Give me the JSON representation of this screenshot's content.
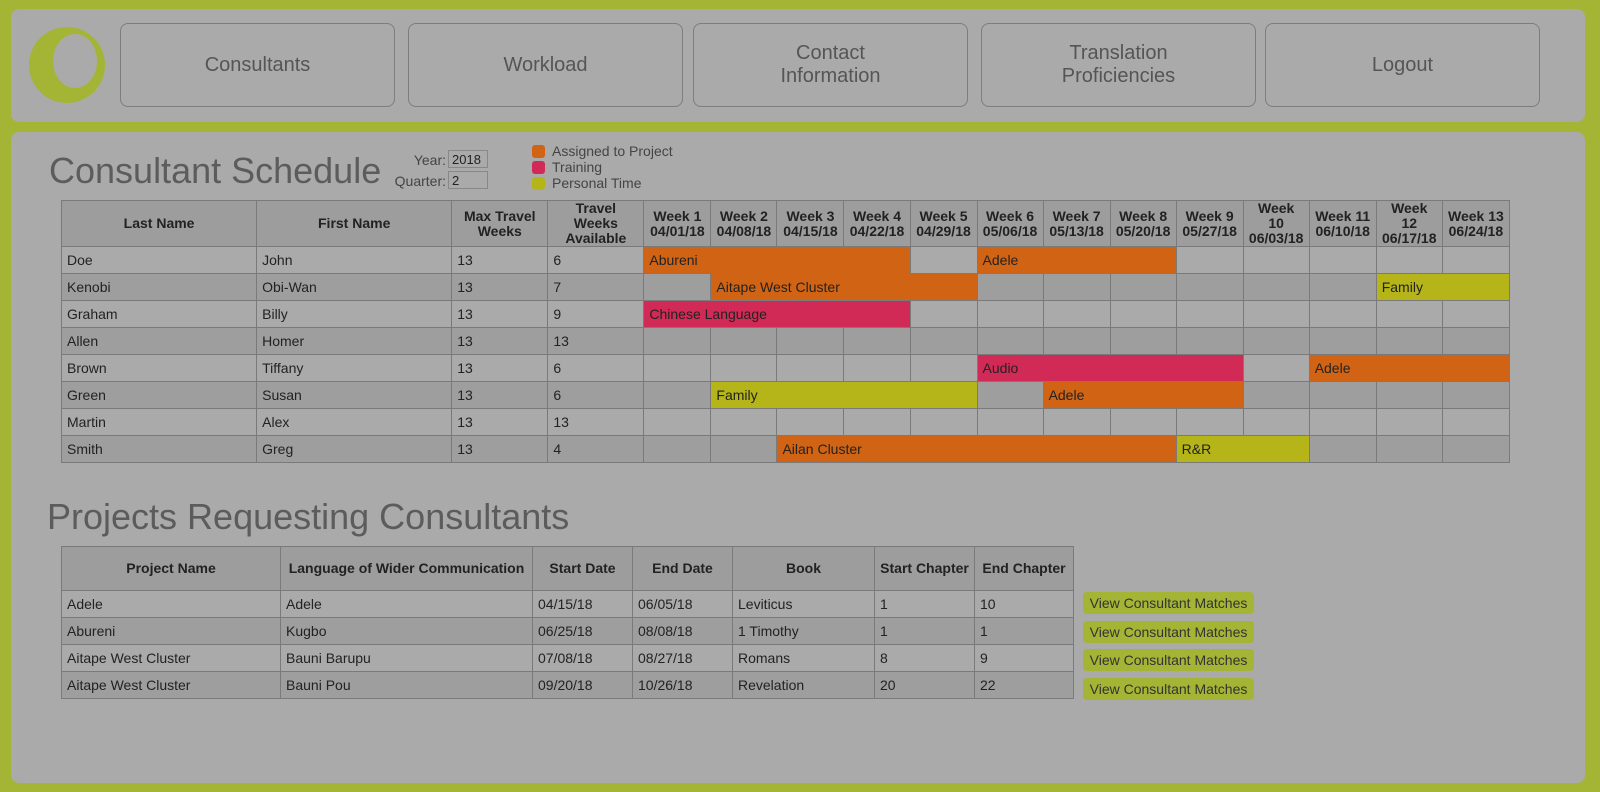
{
  "nav": {
    "items": [
      {
        "label": "Consultants"
      },
      {
        "label": "Workload"
      },
      {
        "label": "Contact\nInformation"
      },
      {
        "label": "Translation\nProficiencies"
      },
      {
        "label": "Logout"
      }
    ]
  },
  "colors": {
    "brand": "#a4b535",
    "assigned": "#d16414",
    "training": "#d22a56",
    "personal": "#b5b51a"
  },
  "schedule": {
    "title": "Consultant Schedule",
    "year_label": "Year:",
    "year_value": "2018",
    "quarter_label": "Quarter:",
    "quarter_value": "2",
    "legend": [
      {
        "label": "Assigned to Project",
        "color": "#d16414"
      },
      {
        "label": "Training",
        "color": "#d22a56"
      },
      {
        "label": "Personal Time",
        "color": "#b5b51a"
      }
    ],
    "headers": [
      "Last Name",
      "First Name",
      "Max Travel Weeks",
      "Travel Weeks Available"
    ],
    "weeks": [
      {
        "label": "Week 1",
        "date": "04/01/18"
      },
      {
        "label": "Week 2",
        "date": "04/08/18"
      },
      {
        "label": "Week 3",
        "date": "04/15/18"
      },
      {
        "label": "Week 4",
        "date": "04/22/18"
      },
      {
        "label": "Week 5",
        "date": "04/29/18"
      },
      {
        "label": "Week 6",
        "date": "05/06/18"
      },
      {
        "label": "Week 7",
        "date": "05/13/18"
      },
      {
        "label": "Week 8",
        "date": "05/20/18"
      },
      {
        "label": "Week 9",
        "date": "05/27/18"
      },
      {
        "label": "Week 10",
        "date": "06/03/18"
      },
      {
        "label": "Week 11",
        "date": "06/10/18"
      },
      {
        "label": "Week 12",
        "date": "06/17/18"
      },
      {
        "label": "Week 13",
        "date": "06/24/18"
      }
    ],
    "rows": [
      {
        "last": "Doe",
        "first": "John",
        "max": "13",
        "avail": "6",
        "bars": [
          {
            "start": 1,
            "span": 4,
            "label": "Abureni",
            "kind": "orange"
          },
          {
            "start": 6,
            "span": 3,
            "label": "Adele",
            "kind": "orange"
          }
        ]
      },
      {
        "last": "Kenobi",
        "first": "Obi-Wan",
        "max": "13",
        "avail": "7",
        "bars": [
          {
            "start": 2,
            "span": 4,
            "label": "Aitape West Cluster",
            "kind": "orange"
          },
          {
            "start": 12,
            "span": 2,
            "label": "Family",
            "kind": "yellow"
          }
        ]
      },
      {
        "last": "Graham",
        "first": "Billy",
        "max": "13",
        "avail": "9",
        "bars": [
          {
            "start": 1,
            "span": 4,
            "label": "Chinese Language",
            "kind": "red"
          }
        ]
      },
      {
        "last": "Allen",
        "first": "Homer",
        "max": "13",
        "avail": "13",
        "bars": []
      },
      {
        "last": "Brown",
        "first": "Tiffany",
        "max": "13",
        "avail": "6",
        "bars": [
          {
            "start": 6,
            "span": 4,
            "label": "Audio",
            "kind": "red"
          },
          {
            "start": 11,
            "span": 3,
            "label": "Adele",
            "kind": "orange"
          }
        ]
      },
      {
        "last": "Green",
        "first": "Susan",
        "max": "13",
        "avail": "6",
        "bars": [
          {
            "start": 2,
            "span": 4,
            "label": "Family",
            "kind": "yellow"
          },
          {
            "start": 7,
            "span": 3,
            "label": "Adele",
            "kind": "orange"
          }
        ]
      },
      {
        "last": "Martin",
        "first": "Alex",
        "max": "13",
        "avail": "13",
        "bars": []
      },
      {
        "last": "Smith",
        "first": "Greg",
        "max": "13",
        "avail": "4",
        "bars": [
          {
            "start": 3,
            "span": 6,
            "label": "Ailan Cluster",
            "kind": "orange"
          },
          {
            "start": 9,
            "span": 2,
            "label": "R&R",
            "kind": "yellow"
          }
        ]
      }
    ]
  },
  "projects": {
    "title": "Projects Requesting Consultants",
    "headers": [
      "Project Name",
      "Language of Wider Communication",
      "Start Date",
      "End Date",
      "Book",
      "Start Chapter",
      "End Chapter"
    ],
    "rows": [
      [
        "Adele",
        "Adele",
        "04/15/18",
        "06/05/18",
        "Leviticus",
        "1",
        "10"
      ],
      [
        "Abureni",
        "Kugbo",
        "06/25/18",
        "08/08/18",
        "1 Timothy",
        "1",
        "1"
      ],
      [
        "Aitape West Cluster",
        "Bauni Barupu",
        "07/08/18",
        "08/27/18",
        "Romans",
        "8",
        "9"
      ],
      [
        "Aitape West Cluster",
        "Bauni Pou",
        "09/20/18",
        "10/26/18",
        "Revelation",
        "20",
        "22"
      ]
    ],
    "match_button_label": "View Consultant Matches"
  }
}
